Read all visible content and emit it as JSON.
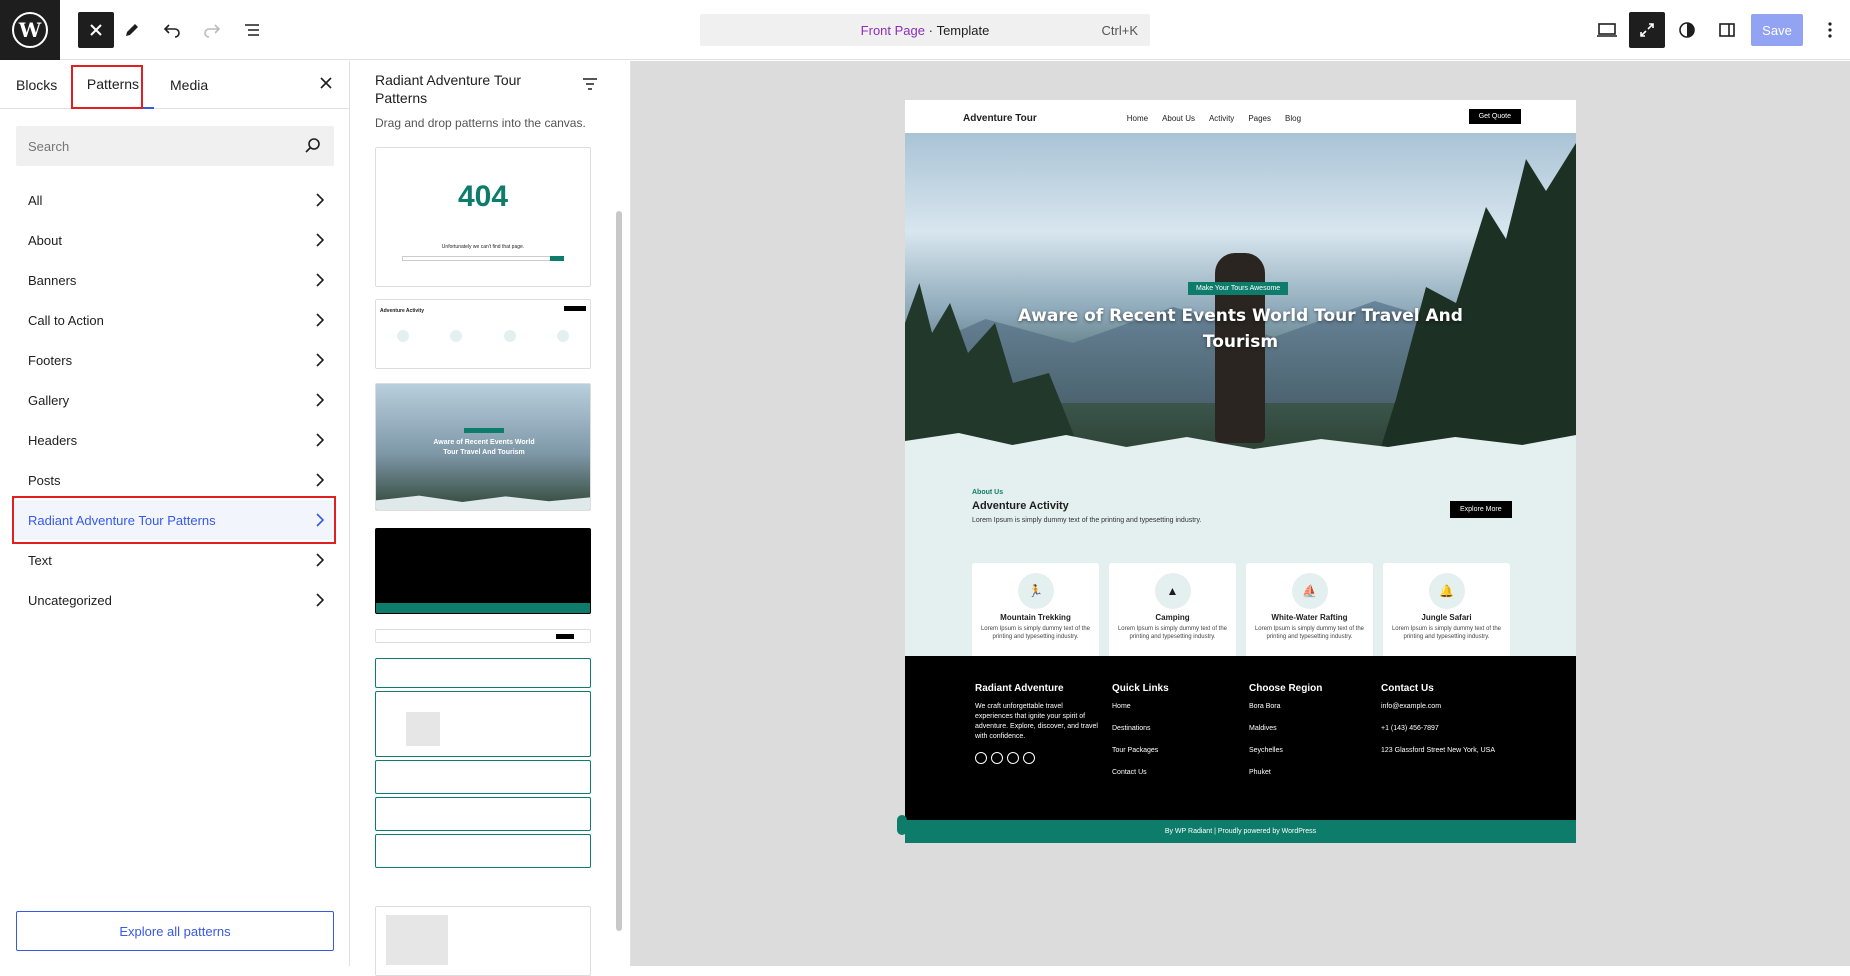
{
  "topbar": {
    "logo": "W",
    "command": {
      "page": "Front Page",
      "sep": " · ",
      "type": "Template",
      "shortcut": "Ctrl+K"
    },
    "save_label": "Save"
  },
  "inserter": {
    "tabs": [
      "Blocks",
      "Patterns",
      "Media"
    ],
    "active_tab": "Patterns",
    "search_placeholder": "Search",
    "categories": [
      "All",
      "About",
      "Banners",
      "Call to Action",
      "Footers",
      "Gallery",
      "Headers",
      "Posts",
      "Radiant Adventure Tour Patterns",
      "Text",
      "Uncategorized"
    ],
    "active_category": "Radiant Adventure Tour Patterns",
    "explore_label": "Explore all patterns"
  },
  "patterns": {
    "title": "Radiant Adventure Tour Patterns",
    "subtitle": "Drag and drop patterns into the canvas.",
    "thumb_404": "404",
    "thumb_404_text": "Unfortunately we can't find that page.",
    "thumb_activity": "Adventure Activity",
    "thumb_hero": "Aware of Recent Events World Tour Travel And Tourism"
  },
  "site": {
    "brand": "Adventure Tour",
    "nav": [
      "Home",
      "About Us",
      "Activity",
      "Pages",
      "Blog"
    ],
    "cta": "Get Quote",
    "hero_badge": "Make Your Tours Awesome",
    "hero_title": "Aware of Recent Events World Tour Travel And Tourism",
    "about_kicker": "About Us",
    "about_title": "Adventure Activity",
    "about_text": "Lorem Ipsum is simply dummy text of the printing and typesetting industry.",
    "explore_more": "Explore More",
    "cards": [
      {
        "title": "Mountain Trekking",
        "text": "Lorem Ipsum is simply dummy text of the printing and typesetting industry."
      },
      {
        "title": "Camping",
        "text": "Lorem Ipsum is simply dummy text of the printing and typesetting industry."
      },
      {
        "title": "White-Water Rafting",
        "text": "Lorem Ipsum is simply dummy text of the printing and typesetting industry."
      },
      {
        "title": "Jungle Safari",
        "text": "Lorem Ipsum is simply dummy text of the printing and typesetting industry."
      }
    ],
    "footer": {
      "col1_title": "Radiant Adventure",
      "col1_text": "We craft unforgettable travel experiences that ignite your spirit of adventure. Explore, discover, and travel with confidence.",
      "col2_title": "Quick Links",
      "col2_items": [
        "Home",
        "Destinations",
        "Tour Packages",
        "Contact Us"
      ],
      "col3_title": "Choose Region",
      "col3_items": [
        "Bora Bora",
        "Maldives",
        "Seychelles",
        "Phuket"
      ],
      "col4_title": "Contact Us",
      "col4_items": [
        "info@example.com",
        "+1 (143) 456-7897",
        "123 Glassford Street New York, USA"
      ],
      "credit": "By WP Radiant | Proudly powered by  WordPress"
    }
  },
  "colors": {
    "accent": "#3858e9",
    "brand_teal": "#0e7c6b",
    "highlight_box": "#e02020"
  }
}
